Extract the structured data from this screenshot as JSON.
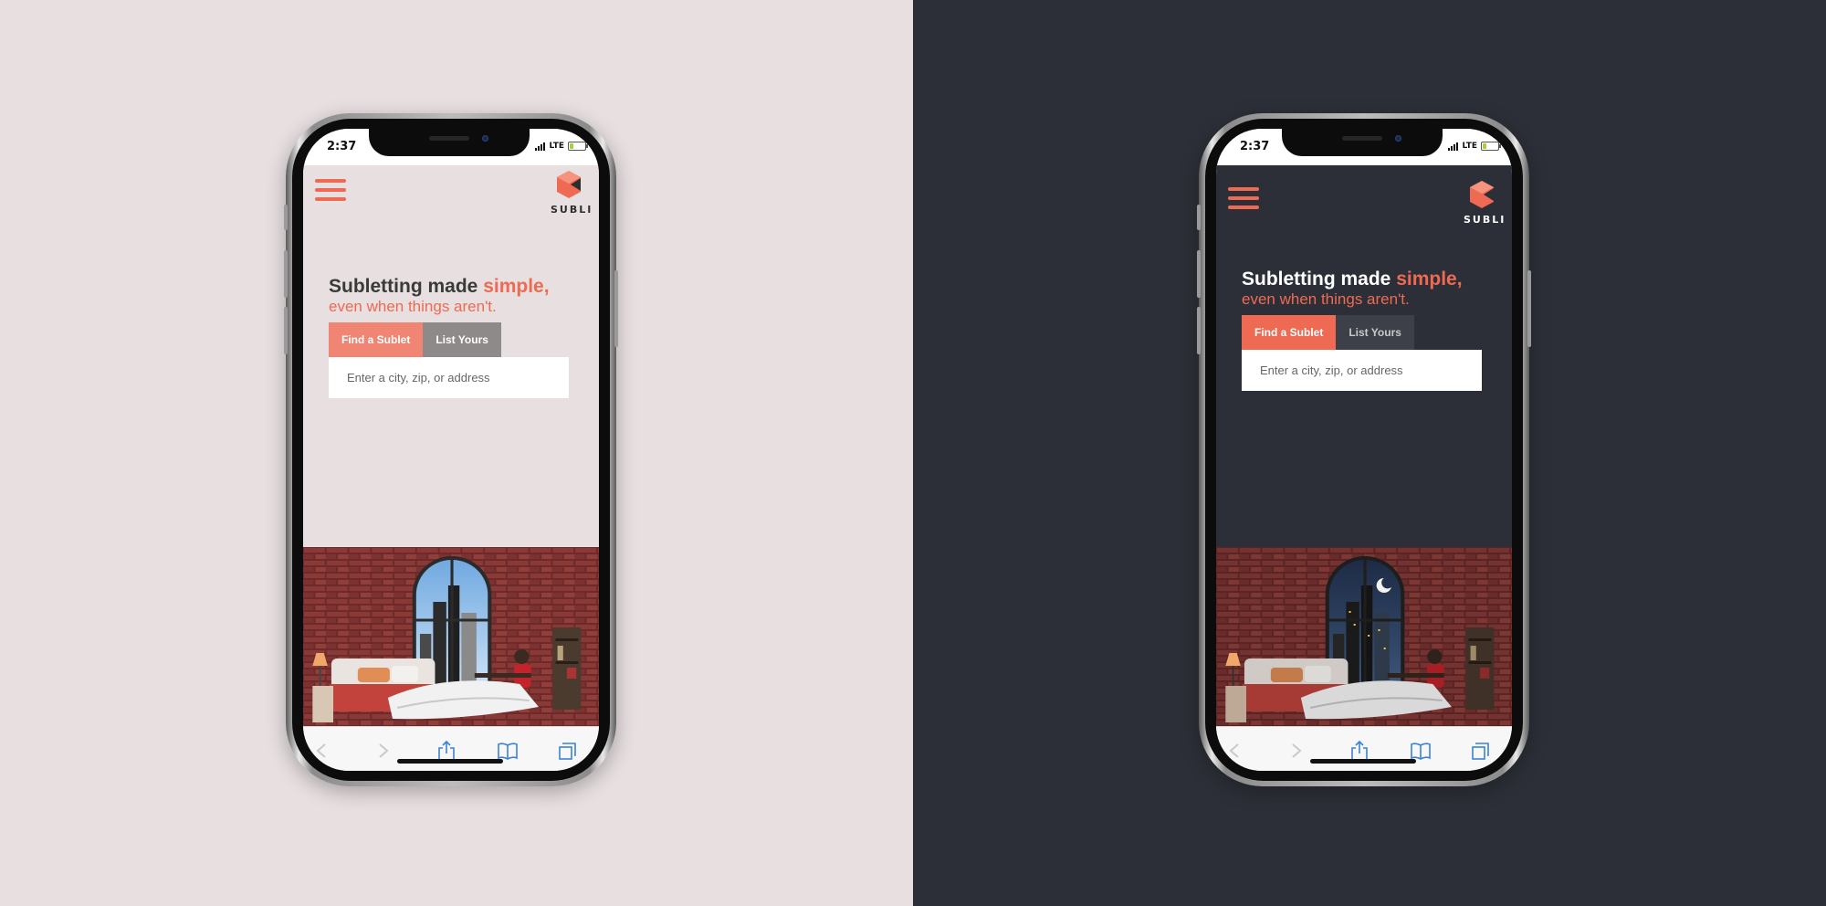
{
  "mockups": {
    "light": {
      "theme": "light",
      "status": {
        "time": "2:37",
        "network": "LTE"
      },
      "logo": {
        "text": "SUBLI",
        "icon": "cube-logo-icon"
      },
      "menu_icon": "hamburger-menu-icon",
      "hero": {
        "title": "Subletting made ",
        "title_accent": "simple,",
        "subtitle": "even when things aren't."
      },
      "tabs": [
        {
          "label": "Find a Sublet",
          "active": true
        },
        {
          "label": "List Yours",
          "active": false
        }
      ],
      "search": {
        "placeholder": "Enter a city, zip, or address",
        "value": ""
      },
      "illustration": "bedroom-day-scene",
      "browser_toolbar": [
        "back-icon",
        "forward-icon",
        "share-icon",
        "bookmarks-icon",
        "tabs-icon"
      ]
    },
    "dark": {
      "theme": "dark",
      "status": {
        "time": "2:37",
        "network": "LTE"
      },
      "logo": {
        "text": "SUBLI",
        "icon": "cube-logo-icon"
      },
      "menu_icon": "hamburger-menu-icon",
      "hero": {
        "title": "Subletting made ",
        "title_accent": "simple,",
        "subtitle": "even when things aren't."
      },
      "tabs": [
        {
          "label": "Find a Sublet",
          "active": true
        },
        {
          "label": "List Yours",
          "active": false
        }
      ],
      "search": {
        "placeholder": "Enter a city, zip, or address",
        "value": ""
      },
      "illustration": "bedroom-night-scene",
      "browser_toolbar": [
        "back-icon",
        "forward-icon",
        "share-icon",
        "bookmarks-icon",
        "tabs-icon"
      ]
    }
  },
  "colors": {
    "light_background": "#e7dfe0",
    "dark_background": "#2c2f37",
    "accent": "#ef6a53",
    "browser_icon": "#3b82d6"
  }
}
